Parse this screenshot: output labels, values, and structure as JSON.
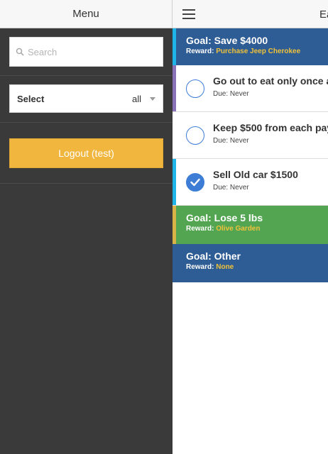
{
  "menu": {
    "title": "Menu",
    "search": {
      "placeholder": "Search",
      "value": ""
    },
    "select": {
      "label": "Select",
      "value": "all"
    },
    "logout_label": "Logout (test)"
  },
  "header": {
    "title": "Ea"
  },
  "goals": [
    {
      "title": "Goal: Save $4000",
      "reward_label": "Reward:",
      "reward": "Purchase Jeep Cherokee",
      "tasks": [
        {
          "title": "Go out to eat only once a",
          "due_label": "Due:",
          "due": "Never",
          "done": false
        },
        {
          "title": "Keep $500 from each pay",
          "due_label": "Due:",
          "due": "Never",
          "done": false
        },
        {
          "title": "Sell Old car $1500",
          "due_label": "Due:",
          "due": "Never",
          "done": true
        }
      ]
    },
    {
      "title": "Goal: Lose 5 lbs",
      "reward_label": "Reward:",
      "reward": "Olive Garden",
      "tasks": []
    },
    {
      "title": "Goal: Other",
      "reward_label": "Reward:",
      "reward": "None",
      "tasks": []
    }
  ],
  "colors": {
    "menu_bg": "#3a3a3a",
    "logout_button": "#f0b63e",
    "goal_blue": "#2e5c94",
    "goal_green": "#54a552",
    "reward_text": "#f0c23a",
    "check_blue": "#3d7dd6"
  }
}
